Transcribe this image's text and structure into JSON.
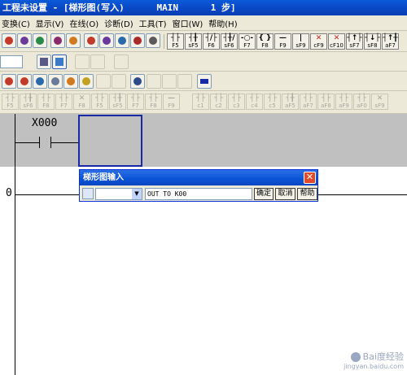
{
  "window": {
    "title": "工程未设置 - [梯形图(写入)      MAIN      1 步]"
  },
  "menubar": {
    "items": [
      "变换(C)",
      "显示(V)",
      "在线(O)",
      "诊断(D)",
      "工具(T)",
      "窗口(W)",
      "帮助(H)"
    ]
  },
  "toolbar_fkeys": [
    {
      "sym": "┤├",
      "key": "F5"
    },
    {
      "sym": "┤╂",
      "key": "sF5"
    },
    {
      "sym": "┤/├",
      "key": "F6"
    },
    {
      "sym": "┤╂/",
      "key": "sF6"
    },
    {
      "sym": "-○-",
      "key": "F7"
    },
    {
      "sym": "{ }",
      "key": "F8"
    },
    {
      "sym": "—",
      "key": "F9"
    },
    {
      "sym": "|",
      "key": "sF9"
    },
    {
      "sym": "✕",
      "key": "cF9"
    },
    {
      "sym": "✕",
      "key": "cF10"
    },
    {
      "sym": "┤↑├",
      "key": "sF7"
    },
    {
      "sym": "┤↓├",
      "key": "sF8"
    },
    {
      "sym": "┤↑╂",
      "key": "aF7"
    },
    {
      "sym": "┤↓╂",
      "key": "aF8"
    }
  ],
  "toolbar_disabled_keys": [
    "F5",
    "sF6",
    "F8",
    "F7",
    "F8",
    "F5",
    "sF5",
    "F7",
    "F8",
    "F9",
    "c1",
    "c2",
    "c3",
    "c4",
    "c5",
    "aF5",
    "aF7",
    "aF8",
    "aF9",
    "aF0",
    "sF9"
  ],
  "ladder": {
    "contact_label": "X000",
    "step_number": "0"
  },
  "dialog": {
    "title": "梯形图输入",
    "close_symbol": "✕",
    "input_value": "OUT TO K00",
    "ok_label": "确定",
    "cancel_label": "取消",
    "help_label": "帮助"
  },
  "watermark": {
    "main": "Bai度经验",
    "sub": "jingyan.baidu.com"
  }
}
